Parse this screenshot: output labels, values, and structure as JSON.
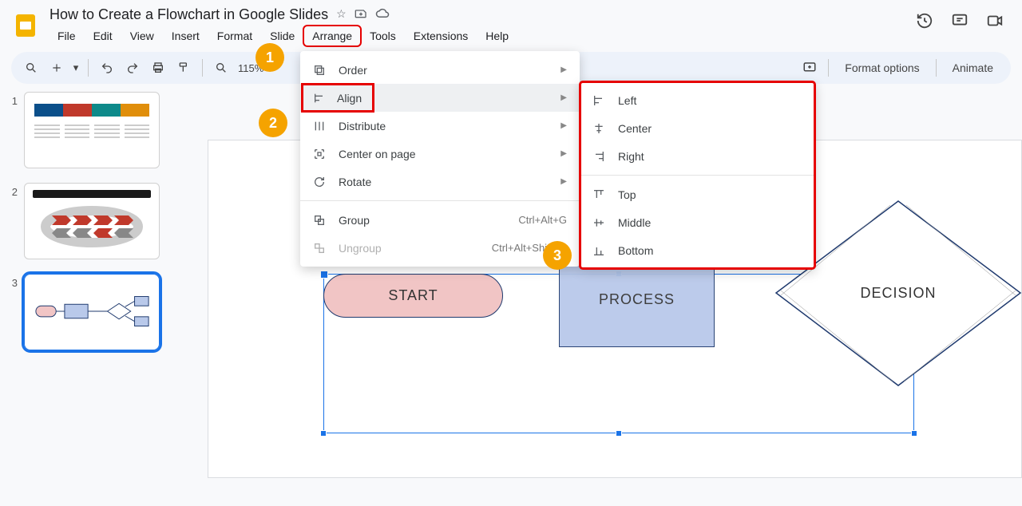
{
  "doc": {
    "title": "How to Create a Flowchart in Google Slides"
  },
  "menubar": [
    "File",
    "Edit",
    "View",
    "Insert",
    "Format",
    "Slide",
    "Arrange",
    "Tools",
    "Extensions",
    "Help"
  ],
  "toolbar": {
    "zoom": "115%",
    "format_options": "Format options",
    "animate": "Animate"
  },
  "arrange_menu": {
    "order": "Order",
    "align": "Align",
    "distribute": "Distribute",
    "center_on_page": "Center on page",
    "rotate": "Rotate",
    "group": "Group",
    "group_shortcut": "Ctrl+Alt+G",
    "ungroup": "Ungroup",
    "ungroup_shortcut": "Ctrl+Alt+Shift+G"
  },
  "align_submenu": {
    "left": "Left",
    "center": "Center",
    "right": "Right",
    "top": "Top",
    "middle": "Middle",
    "bottom": "Bottom"
  },
  "flowchart": {
    "start": "START",
    "process": "PROCESS",
    "decision": "DECISION"
  },
  "thumbs": [
    "1",
    "2",
    "3"
  ],
  "annotations": {
    "a1": "1",
    "a2": "2",
    "a3": "3"
  }
}
